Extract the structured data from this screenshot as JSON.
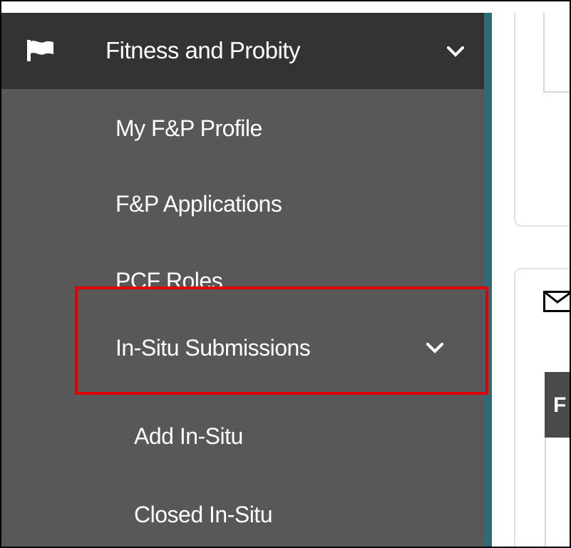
{
  "sidebar": {
    "header": {
      "label": "Fitness and Probity",
      "icon": "flag-icon",
      "chevron": "chevron-down-icon"
    },
    "items": [
      {
        "label": "My F&P Profile"
      },
      {
        "label": "F&P Applications"
      },
      {
        "label": "PCF Roles"
      },
      {
        "label": "In-Situ Submissions",
        "chevron": "chevron-down-icon",
        "highlighted": true
      }
    ],
    "sub_items": [
      {
        "label": "Add In-Situ"
      },
      {
        "label": "Closed In-Situ"
      }
    ]
  },
  "content": {
    "table_header_partial": "F",
    "envelope_icon": "envelope-icon"
  },
  "colors": {
    "sidebar_bg": "#585858",
    "header_bg": "#333333",
    "accent": "#2b6c78",
    "highlight": "#e10000"
  }
}
